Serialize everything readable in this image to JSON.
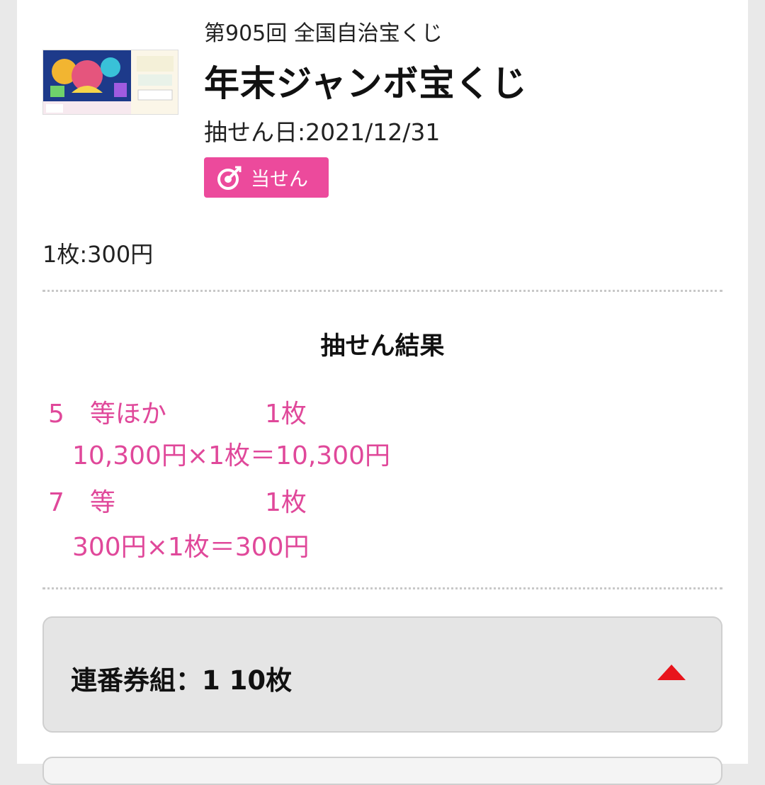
{
  "lottery": {
    "round": "第905回 全国自治宝くじ",
    "title": "年末ジャンボ宝くじ",
    "draw_date": "抽せん日:2021/12/31",
    "status_badge": "当せん",
    "status_icon": "target-icon",
    "price": "1枚:300円"
  },
  "results": {
    "heading": "抽せん結果",
    "items": [
      {
        "grade": "5　等ほか",
        "count": "1枚",
        "formula": "10,300円×1枚＝10,300円"
      },
      {
        "grade": "7　等",
        "count": "1枚",
        "formula": "300円×1枚＝300円"
      }
    ]
  },
  "group": {
    "label": "連番券組：1  10枚",
    "caret_icon": "caret-up-icon",
    "expanded": true
  },
  "colors": {
    "accent_pink": "#ec4a9c",
    "result_pink": "#e0489a",
    "caret_red": "#e8141b"
  }
}
